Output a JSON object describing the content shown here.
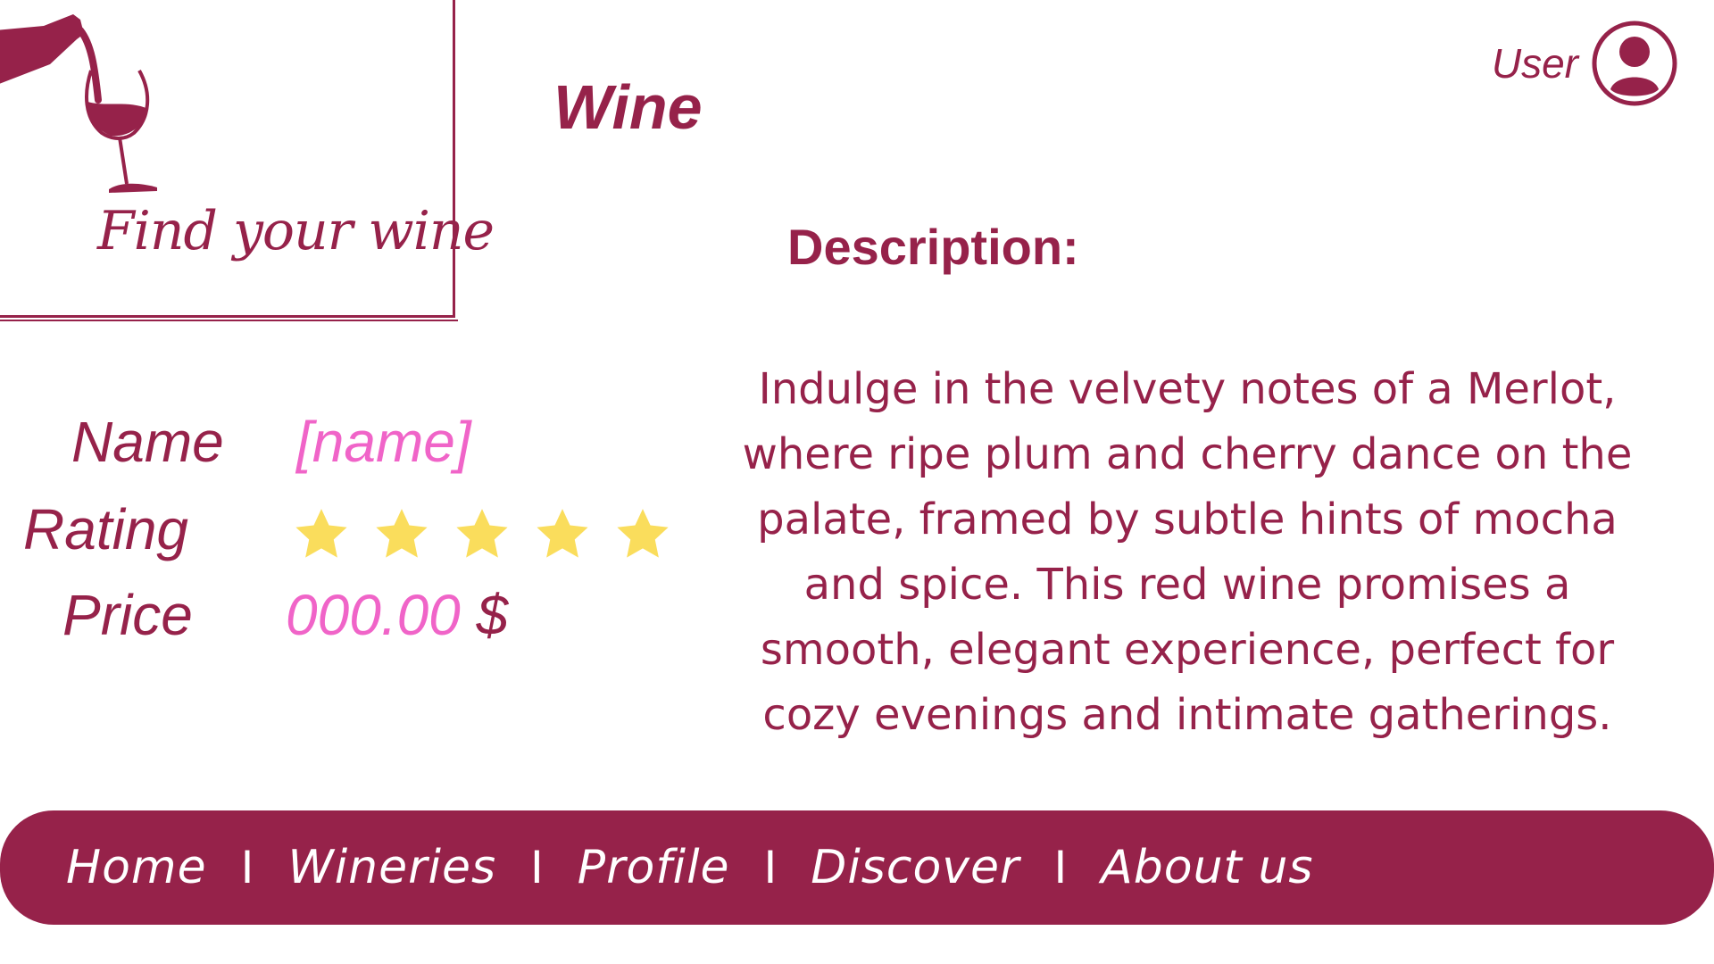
{
  "logo": {
    "text": "Find your wine",
    "icon": "wine-pour-icon"
  },
  "title": "Wine",
  "user": {
    "label": "User",
    "icon": "user-avatar-icon"
  },
  "description": {
    "heading": "Description:",
    "text": "Indulge in the velvety notes of a Merlot, where ripe plum and cherry dance on the palate, framed by subtle hints of mocha and spice. This red wine promises a smooth, elegant experience, perfect for cozy evenings and intimate gatherings."
  },
  "details": {
    "name_label": "Name",
    "name_value": "[name]",
    "rating_label": "Rating",
    "rating_value": 5,
    "rating_max": 5,
    "price_label": "Price",
    "price_value": "000.00",
    "price_currency": "$"
  },
  "nav": {
    "items": [
      "Home",
      "Wineries",
      "Profile",
      "Discover",
      "About us"
    ],
    "separator": "I"
  },
  "colors": {
    "brand": "#96224a",
    "accent_pink": "#f064c8",
    "star": "#fadd5c",
    "background": "#ffffff"
  }
}
